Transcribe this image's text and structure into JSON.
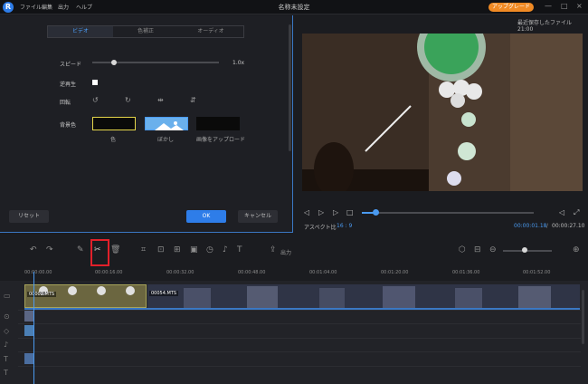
{
  "app": {
    "title": "名称未設定",
    "menu": [
      "ファイル",
      "編集",
      "出力",
      "ヘルプ"
    ],
    "upgrade_label": "アップグレード",
    "autosave": "最近保存したファイル 21:00",
    "win_controls": [
      "—",
      "□",
      "×"
    ]
  },
  "settings": {
    "tabs": [
      "ビデオ",
      "色補正",
      "オーディオ"
    ],
    "active_tab": "ビデオ",
    "speed_label": "スピード",
    "speed_value": "1.0x",
    "speed_fraction": 0.17,
    "reverse_label": "逆再生",
    "rotate_label": "回転",
    "background_label": "背景色",
    "bg_options": [
      "色",
      "ぼかし",
      "画像をアップロード"
    ],
    "reset_label": "リセット",
    "ok_label": "OK",
    "cancel_label": "キャンセル"
  },
  "player": {
    "aspect_label": "アスペクト比",
    "aspect_value": "16 : 9",
    "current_time": "00:00:01.18",
    "total_time": "00:00:27.10",
    "progress": 0.08
  },
  "toolbar": {
    "export_label": "出力",
    "icons": [
      "undo-icon",
      "redo-icon",
      "pencil-icon",
      "scissors-icon",
      "trash-icon",
      "crop-icon",
      "freeze-icon",
      "speed-icon",
      "camera-icon",
      "timer-icon",
      "mic-icon",
      "tts-icon",
      "export-icon"
    ]
  },
  "ruler": {
    "ticks": [
      "00:00:00.00",
      "00:00:16.00",
      "00:00:32.00",
      "00:00:48.00",
      "00:01:04.00",
      "00:01:20.00",
      "00:01:36.00",
      "00:01:52.00"
    ]
  },
  "timeline": {
    "clips": [
      "00002.MTS",
      "00054.MTS"
    ]
  },
  "colors": {
    "accent": "#4a9af0",
    "upgrade": "#f08a24",
    "highlight": "#e2202a"
  }
}
